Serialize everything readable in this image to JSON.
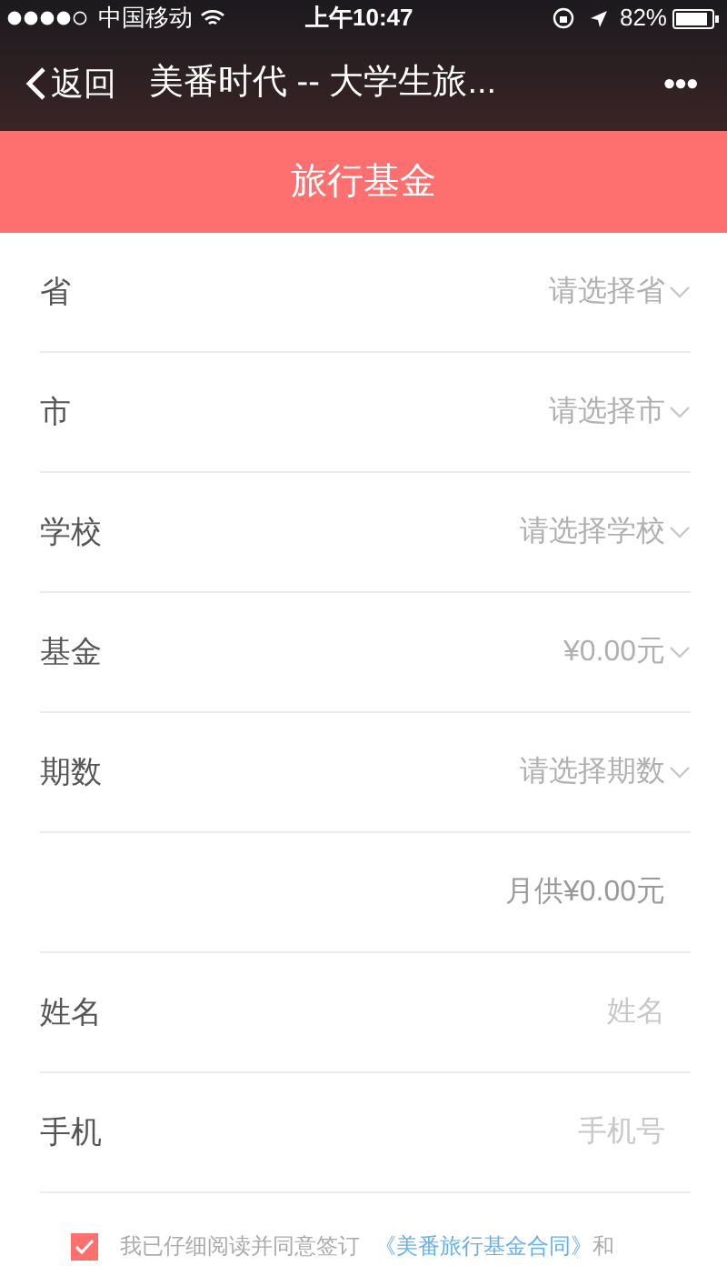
{
  "status_bar": {
    "carrier": "中国移动",
    "time": "上午10:47",
    "battery": "82%"
  },
  "nav_bar": {
    "back": "返回",
    "title": "美番时代 -- 大学生旅...",
    "more": "•••"
  },
  "header": {
    "title": "旅行基金"
  },
  "form": [
    {
      "kind": "select",
      "label": "省",
      "placeholder": "请选择省"
    },
    {
      "kind": "select",
      "label": "市",
      "placeholder": "请选择市"
    },
    {
      "kind": "select",
      "label": "学校",
      "placeholder": "请选择学校"
    },
    {
      "kind": "select",
      "label": "基金",
      "value": "¥0.00元"
    },
    {
      "kind": "select",
      "label": "期数",
      "placeholder": "请选择期数"
    },
    {
      "kind": "note",
      "text": "月供¥0.00元"
    },
    {
      "kind": "input",
      "label": "姓名",
      "placeholder": "姓名"
    },
    {
      "kind": "input",
      "label": "手机",
      "placeholder": "手机号"
    }
  ],
  "agreement": {
    "checked": true,
    "text_before": "我已仔细阅读并同意签订",
    "link": "《美番旅行基金合同》",
    "text_after": "和"
  }
}
